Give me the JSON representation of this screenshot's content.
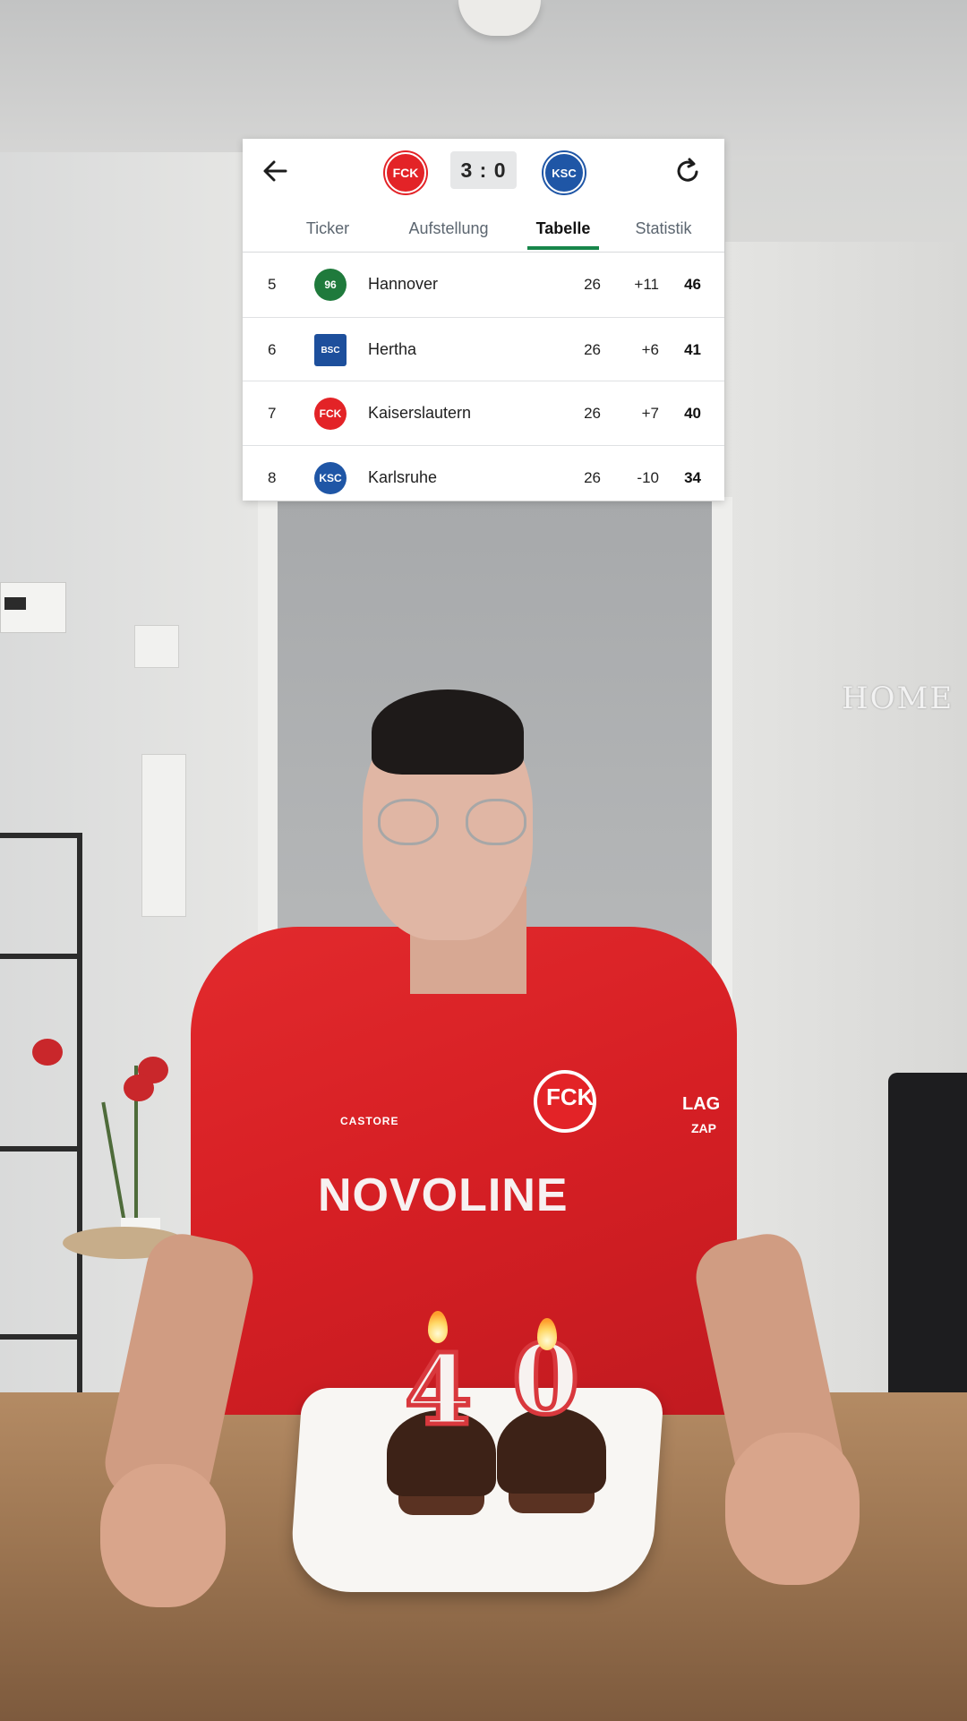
{
  "header": {
    "score": "3 : 0",
    "home_team_logo": "fck-logo",
    "away_team_logo": "ksc-logo",
    "home_logo_text": "FCK",
    "away_logo_text": "KSC"
  },
  "tabs": [
    {
      "label": "Ticker",
      "active": false
    },
    {
      "label": "Aufstellung",
      "active": false
    },
    {
      "label": "Tabelle",
      "active": true
    },
    {
      "label": "Statistik",
      "active": false
    }
  ],
  "table": {
    "rows": [
      {
        "rank": "5",
        "club": "Hannover",
        "logo_text": "96",
        "logo_color": "#1f7a3c",
        "played": "26",
        "diff": "+11",
        "points": "46"
      },
      {
        "rank": "6",
        "club": "Hertha",
        "logo_text": "BSC",
        "logo_color": "#1d4f9c",
        "played": "26",
        "diff": "+6",
        "points": "41"
      },
      {
        "rank": "7",
        "club": "Kaiserslautern",
        "logo_text": "FCK",
        "logo_color": "#e32327",
        "played": "26",
        "diff": "+7",
        "points": "40"
      },
      {
        "rank": "8",
        "club": "Karlsruhe",
        "logo_text": "KSC",
        "logo_color": "#1f56a6",
        "played": "26",
        "diff": "-10",
        "points": "34"
      }
    ]
  },
  "scene": {
    "shirt_sponsor": "NOVOLINE",
    "shirt_brand": "CASTORE",
    "shirt_sleeve_text_1": "LAG",
    "shirt_sleeve_text_2": "ZAP",
    "candle_digit_1": "4",
    "candle_digit_2": "0",
    "wall_sign": "HOME"
  },
  "colors": {
    "accent": "#17864a",
    "home_red": "#e32327",
    "away_blue": "#1f56a6"
  }
}
